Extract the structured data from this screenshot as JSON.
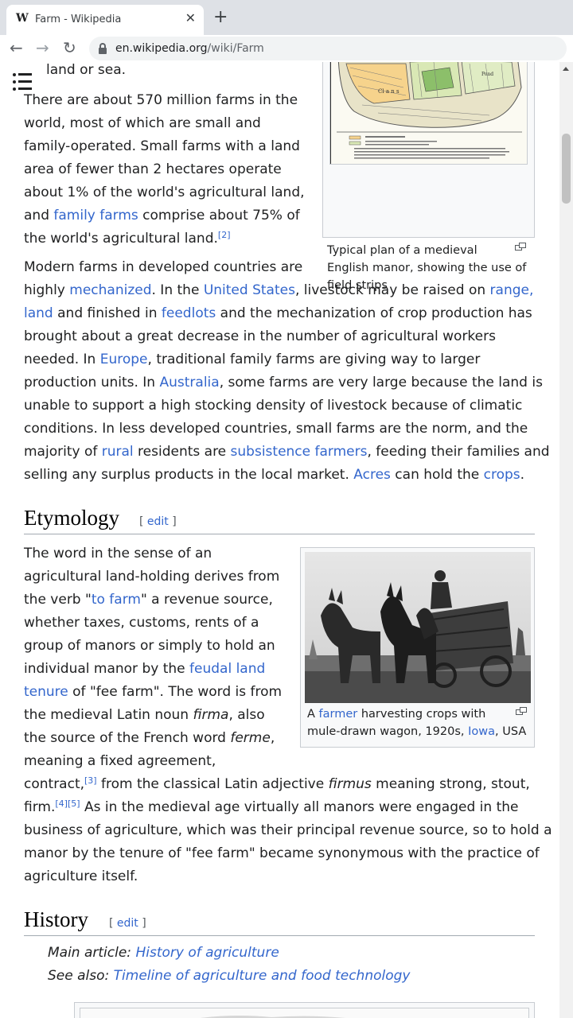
{
  "browser": {
    "tab_title": "Farm - Wikipedia",
    "tab_favicon": "W",
    "url_host": "en.wikipedia.org",
    "url_path": "/wiki/Farm"
  },
  "icons": {
    "close": "close-icon",
    "new_tab": "plus-icon",
    "back": "arrow-left-icon",
    "forward": "arrow-right-icon",
    "reload": "reload-icon",
    "lock": "lock-icon",
    "toc": "table-of-contents-icon",
    "magnify": "enlarge-icon"
  },
  "colors": {
    "link": "#3366cc",
    "text": "#202122"
  },
  "article": {
    "intro_tail": "land or sea.",
    "p1": {
      "l1": "There are about 570 million farms in the",
      "l2": "world, most of which are small and",
      "l3": "family-operated. Small farms with a land",
      "l4": "area of fewer than 2 hectares operate",
      "l5": "about 1% of the world's agricultural land,",
      "l6a": "and ",
      "l6_link": "family farms",
      "l6b": " comprise about 75% of",
      "l7": "the world's agricultural land.",
      "ref2": "[2]"
    },
    "p2": {
      "l1": "Modern farms in developed countries are",
      "l2a": "highly ",
      "l2_link1": "mechanized",
      "l2b": ". In the ",
      "l2_link2": "United States",
      "l2c": ", livestock may be raised on ",
      "l2_link3": "range,",
      "l3_link1": "land",
      "l3a": " and finished in ",
      "l3_link2": "feedlots",
      "l3b": " and the mechanization of crop production has",
      "l4": "brought about a great decrease in the number of agricultural workers",
      "l5a": "needed. In ",
      "l5_link": "Europe",
      "l5b": ", traditional family farms are giving way to larger",
      "l6a": "production units. In ",
      "l6_link": "Australia",
      "l6b": ", some farms are very large because the land is",
      "l7": "unable to support a high stocking density of livestock because of climatic",
      "l8": "conditions. In less developed countries, small farms are the norm, and the",
      "l9a": "majority of ",
      "l9_link1": "rural",
      "l9b": " residents are ",
      "l9_link2": "subsistence farmers",
      "l9c": ", feeding their families and",
      "l10a": "selling any surplus products in the local market. ",
      "l10_link1": "Acres",
      "l10b": " can hold the ",
      "l10_link2": "crops",
      "l10c": "."
    },
    "manor_figure": {
      "cap1": "Typical plan of a medieval",
      "cap2": "English manor, showing the use of",
      "cap3": "field strips"
    },
    "etymology": {
      "heading": "Etymology",
      "edit_open": "[ ",
      "edit": "edit",
      "edit_close": " ]",
      "l1": "The word in the sense of an",
      "l2": "agricultural land-holding derives from",
      "l3": "the verb \"to farm\" a revenue source,",
      "l3a": "the verb \"",
      "l3_link": "to farm",
      "l3b": "\" a revenue source,",
      "l4": "whether taxes, customs, rents of a",
      "l5": "group of manors or simply to hold an",
      "l6a": "individual manor by the ",
      "l6_link": "feudal land",
      "l7_link": "tenure",
      "l7b": " of \"fee farm\". The word is from",
      "l8a": "the medieval Latin noun ",
      "l8_i": "firma",
      "l8b": ", also",
      "l9a": "the source of the French word ",
      "l9_i": "ferme",
      "l9b": ",",
      "l10": "meaning a fixed agreement,",
      "l11a": "contract,",
      "ref3": "[3]",
      "l11b": " from the classical Latin adjective ",
      "l11_i": "firmus",
      "l11c": " meaning strong, stout,",
      "l12a": "firm.",
      "ref4": "[4]",
      "ref5": "[5]",
      "l12b": " As in the medieval age virtually all manors were engaged in the",
      "l13": "business of agriculture, which was their principal revenue source, so to hold a",
      "l14": "manor by the tenure of \"fee farm\" became synonymous with the practice of",
      "l15": "agriculture itself."
    },
    "farmer_figure": {
      "cap1a": "A ",
      "cap1_link": "farmer",
      "cap1b": " harvesting crops with",
      "cap2a": "mule-drawn wagon, 1920s, ",
      "cap2_link": "Iowa",
      "cap2b": ", USA"
    },
    "history": {
      "heading": "History",
      "edit_open": "[ ",
      "edit": "edit",
      "edit_close": " ]",
      "main_label": "Main article: ",
      "main_link": "History of agriculture",
      "see_label": "See also: ",
      "see_link": "Timeline of agriculture and food technology"
    }
  }
}
